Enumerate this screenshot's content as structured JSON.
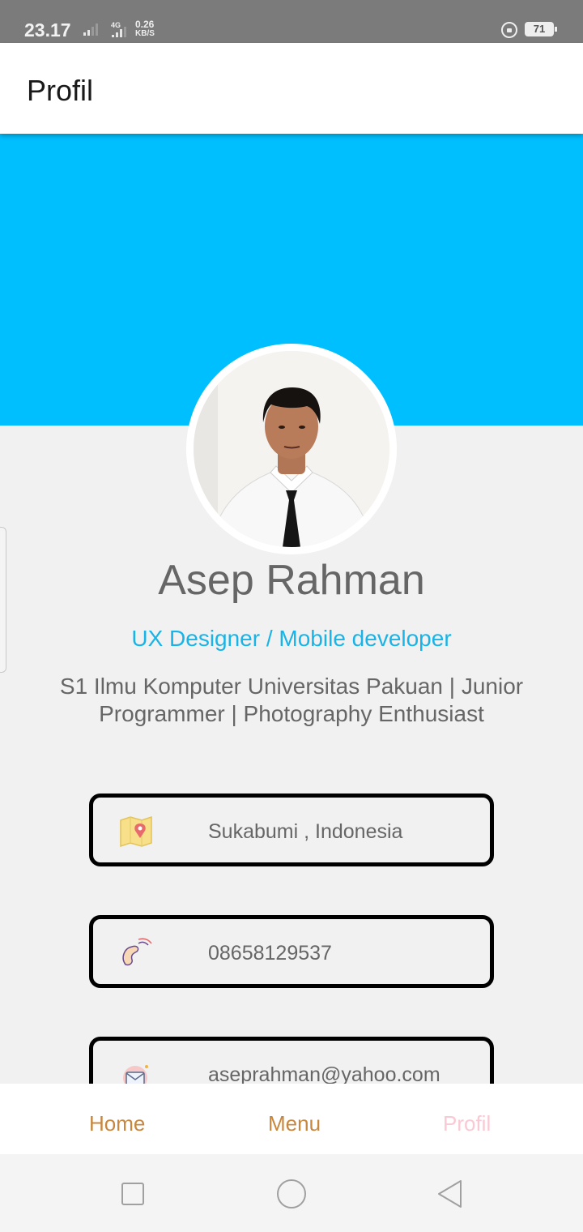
{
  "status_bar": {
    "time": "23.17",
    "network": "4G",
    "speed_value": "0.26",
    "speed_unit": "KB/S",
    "battery": "71"
  },
  "app_bar": {
    "title": "Profil"
  },
  "profile": {
    "name": "Asep Rahman",
    "role": "UX Designer / Mobile developer",
    "bio": "S1 Ilmu Komputer Universitas Pakuan | Junior Programmer | Photography Enthusiast",
    "banner_color": "#00bffe"
  },
  "contacts": [
    {
      "icon": "map-location-icon",
      "value": "Sukabumi , Indonesia"
    },
    {
      "icon": "phone-icon",
      "value": "08658129537"
    },
    {
      "icon": "mail-icon",
      "value": "aseprahman@yahoo.com"
    }
  ],
  "bottom_nav": {
    "items": [
      {
        "label": "Home",
        "active": false
      },
      {
        "label": "Menu",
        "active": false
      },
      {
        "label": "Profil",
        "active": true
      }
    ]
  },
  "colors": {
    "accent": "#18b4e8",
    "nav_label": "#c8873e",
    "nav_active": "#f9c9d4"
  }
}
